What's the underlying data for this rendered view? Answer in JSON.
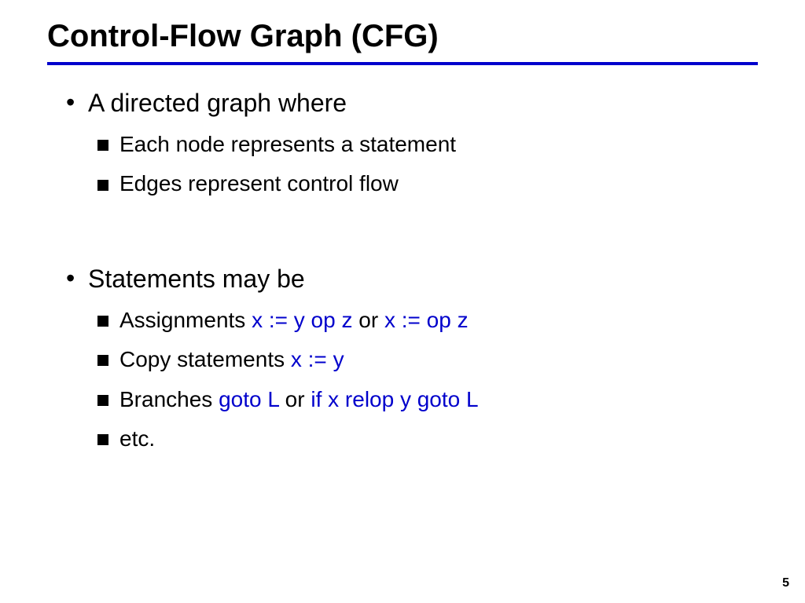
{
  "title": "Control-Flow Graph (CFG)",
  "page_number": "5",
  "sections": [
    {
      "heading": "A directed graph where",
      "items": [
        {
          "parts": [
            {
              "t": "Each node represents a statement"
            }
          ]
        },
        {
          "parts": [
            {
              "t": "Edges represent control flow"
            }
          ]
        }
      ]
    },
    {
      "heading": "Statements may be",
      "items": [
        {
          "parts": [
            {
              "t": "Assignments "
            },
            {
              "t": "x := y op z",
              "c": "blue"
            },
            {
              "t": " or "
            },
            {
              "t": "x := op z",
              "c": "blue"
            }
          ]
        },
        {
          "parts": [
            {
              "t": "Copy statements "
            },
            {
              "t": "x := y",
              "c": "blue"
            }
          ]
        },
        {
          "parts": [
            {
              "t": "Branches "
            },
            {
              "t": "goto L",
              "c": "blue"
            },
            {
              "t": " or "
            },
            {
              "t": "if x relop y goto L",
              "c": "blue"
            }
          ]
        },
        {
          "parts": [
            {
              "t": "etc."
            }
          ]
        }
      ]
    }
  ]
}
